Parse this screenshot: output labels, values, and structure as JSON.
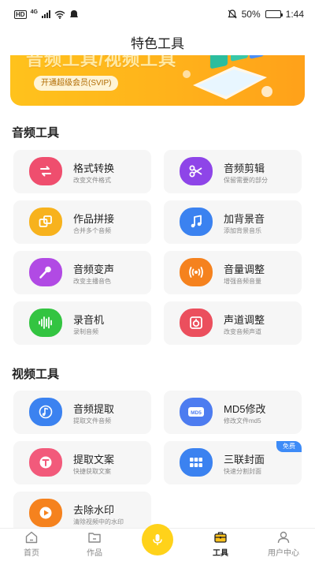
{
  "status_bar": {
    "hd": "HD",
    "network": "4G",
    "battery_text": "50%",
    "battery_level": 0.5,
    "time": "1:44"
  },
  "header": {
    "title": "特色工具"
  },
  "banner": {
    "title": "音频工具/视频工具",
    "button": "开通超级会员(SVIP)"
  },
  "audio_section": {
    "title": "音频工具",
    "items": [
      {
        "name": "格式转换",
        "desc": "改变文件格式",
        "icon": "convert-icon",
        "color": "#ef4e6e"
      },
      {
        "name": "音频剪辑",
        "desc": "保留需要的部分",
        "icon": "scissors-icon",
        "color": "#8e45e8"
      },
      {
        "name": "作品拼接",
        "desc": "合并多个音频",
        "icon": "merge-icon",
        "color": "#f7b21d"
      },
      {
        "name": "加背景音",
        "desc": "添加背景音乐",
        "icon": "music-note-icon",
        "color": "#3b82f0"
      },
      {
        "name": "音频变声",
        "desc": "改变主播音色",
        "icon": "microphone-icon",
        "color": "#b14ae4"
      },
      {
        "name": "音量调整",
        "desc": "增强音频音量",
        "icon": "volume-wave-icon",
        "color": "#f5821e"
      },
      {
        "name": "录音机",
        "desc": "录制音频",
        "icon": "waveform-icon",
        "color": "#33c441"
      },
      {
        "name": "声道调整",
        "desc": "改变音频声道",
        "icon": "speaker-icon",
        "color": "#eb4f5d"
      }
    ]
  },
  "video_section": {
    "title": "视频工具",
    "items": [
      {
        "name": "音频提取",
        "desc": "提取文件音频",
        "icon": "extract-audio-icon",
        "color": "#3b82f0"
      },
      {
        "name": "MD5修改",
        "desc": "修改文件md5",
        "icon": "md5-icon",
        "color": "#4d7cf0",
        "icon_text": "MD5"
      },
      {
        "name": "提取文案",
        "desc": "快捷获取文案",
        "icon": "text-extract-icon",
        "color": "#f25a7b"
      },
      {
        "name": "三联封面",
        "desc": "快速分割封面",
        "icon": "grid-icon",
        "color": "#3b82f0",
        "badge": "免费"
      },
      {
        "name": "去除水印",
        "desc": "清除视频中的水印",
        "icon": "play-icon",
        "color": "#f5821e"
      }
    ]
  },
  "tabbar": {
    "items": [
      {
        "label": "首页",
        "icon": "home-icon"
      },
      {
        "label": "作品",
        "icon": "folder-icon"
      },
      {
        "label": "",
        "icon": "microphone-icon"
      },
      {
        "label": "工具",
        "icon": "toolbox-icon"
      },
      {
        "label": "用户中心",
        "icon": "user-icon"
      }
    ],
    "active": "工具",
    "accent": "#ffd21a"
  }
}
